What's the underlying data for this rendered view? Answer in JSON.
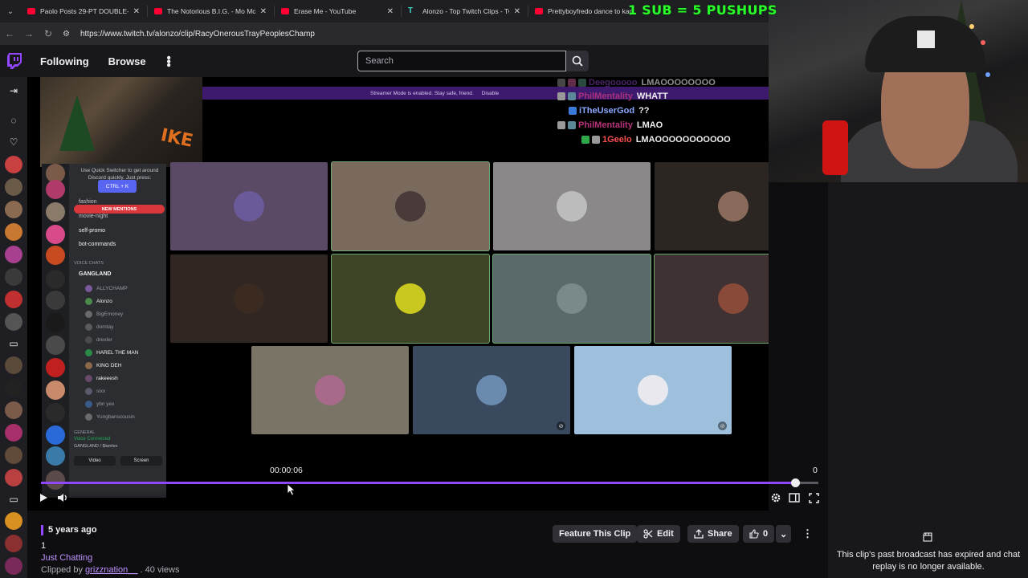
{
  "browser": {
    "tabs": [
      {
        "title": "Paolo Posts 29-PT DOUBLE-DO",
        "icon": "youtube-icon"
      },
      {
        "title": "The Notorious B.I.G. - Mo Mone",
        "icon": "youtube-icon"
      },
      {
        "title": "Erase Me - YouTube",
        "icon": "youtube-icon"
      },
      {
        "title": "Alonzo - Top Twitch Clips - Twit",
        "icon": "twitch-tracker-icon"
      },
      {
        "title": "Prettyboyfredo dance to kap",
        "icon": "youtube-icon"
      }
    ],
    "url": "https://www.twitch.tv/alonzo/clip/RacyOnerousTrayPeoplesChamp"
  },
  "overlay": {
    "sub_banner": "1 SUB = 5 PUSHUPS"
  },
  "nav": {
    "following": "Following",
    "browse": "Browse",
    "search_placeholder": "Search"
  },
  "stream": {
    "streamer_mode_text": "Streamer Mode is enabled. Stay safe, friend.",
    "streamer_mode_disable": "Disable",
    "chat": [
      {
        "user": "Deegooooo",
        "msg": "LMAOOOOOOOO",
        "color": "#7a3fa8"
      },
      {
        "user": "PhilMentality",
        "msg": "WHATT",
        "color": "#a8327a"
      },
      {
        "user": "iTheUserGod",
        "msg": "??",
        "color": "#8aa8ff"
      },
      {
        "user": "PhilMentality",
        "msg": "LMAO",
        "color": "#b8327a"
      },
      {
        "user": "1Geelo",
        "msg": "LMAOOOOOOOOOOO",
        "color": "#ff4f4f"
      }
    ],
    "discord": {
      "tip": "Use Quick Switcher to get around Discord quickly. Just press:",
      "ctrl_k": "CTRL + K",
      "new_mentions": "NEW MENTIONS",
      "channels": [
        "fashion",
        "movie-night",
        "self-promo",
        "bot-commands"
      ],
      "voice_category": "VOICE CHATS",
      "voice_channel": "GANGLAND",
      "voice_users": [
        "ALLYCHAMP",
        "Alonzo",
        "BigEmoney",
        "domtay",
        "drexler",
        "HAREL THE MAN",
        "KING DEH",
        "rakeeesh",
        "sixx",
        "ybn yex",
        "Yungbanscousin"
      ],
      "general": "GENERAL",
      "voice_connected": "Voice Connected",
      "voice_sub": "GANGLAND / $lamlex",
      "video_btn": "Video",
      "screen_btn": "Screen"
    }
  },
  "player": {
    "timestamp": "00:00:06",
    "viewer_count": "0",
    "progress": 0.97
  },
  "clip": {
    "age": "5 years ago",
    "title": "1",
    "category": "Just Chatting",
    "clipped_by_prefix": "Clipped by",
    "clipper": "grizznation__",
    "views": ". 40 views",
    "feature_btn": "Feature This Clip",
    "edit_btn": "Edit",
    "share_btn": "Share",
    "like_count": "0"
  },
  "right_panel": {
    "expired_msg": "This clip's past broadcast has expired and chat replay is no longer available."
  },
  "colors": {
    "twitch_purple": "#9147ff",
    "link_purple": "#bf94ff",
    "sub_green": "#2bff2b"
  }
}
